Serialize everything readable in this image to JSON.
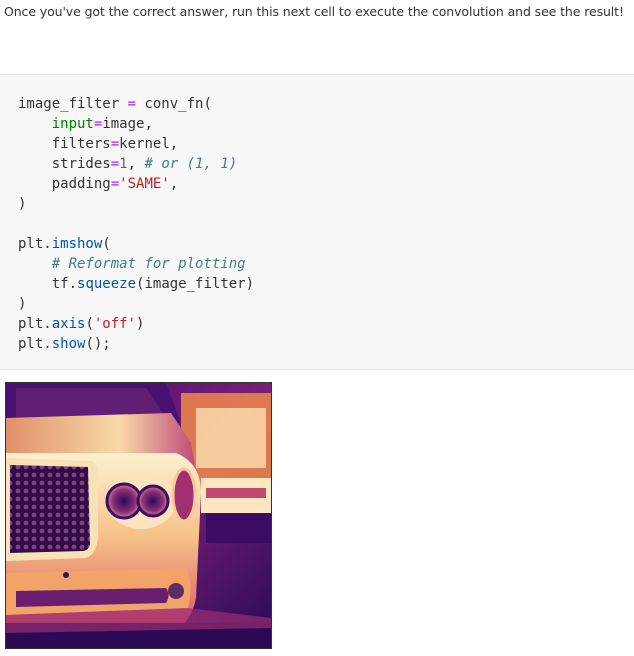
{
  "intro": {
    "text": "Once you've got the correct answer, run this next cell to execute the convolution and see the result!"
  },
  "code": {
    "l1_a": "image_filter ",
    "l1_op": "=",
    "l1_b": " conv_fn(",
    "l2_indent": "    ",
    "l2_kw": "input",
    "l2_op": "=",
    "l2_val": "image,",
    "l3_indent": "    ",
    "l3_kw": "filters",
    "l3_op": "=",
    "l3_val": "kernel,",
    "l4_indent": "    ",
    "l4_kw": "strides",
    "l4_op": "=",
    "l4_num": "1",
    "l4_comma": ", ",
    "l4_comment": "# or (1, 1)",
    "l5_indent": "    ",
    "l5_kw": "padding",
    "l5_op": "=",
    "l5_str": "'SAME'",
    "l5_comma": ",",
    "l6": ")",
    "l8_a": "plt.",
    "l8_fn": "imshow",
    "l8_b": "(",
    "l9_indent": "    ",
    "l9_comment": "# Reformat for plotting",
    "l10_indent": "    ",
    "l10_a": "tf.",
    "l10_fn": "squeeze",
    "l10_b": "(image_filter)",
    "l11": ")",
    "l12_a": "plt.",
    "l12_fn": "axis",
    "l12_b": "(",
    "l12_str": "'off'",
    "l12_c": ")",
    "l13_a": "plt.",
    "l13_fn": "show",
    "l13_b": "();"
  },
  "output": {
    "image_desc_icon": "car-front-image-icon",
    "colors": {
      "dark": "#2a0a55",
      "mid": "#b0306e",
      "warm": "#f08a4a",
      "light": "#fbe0b0",
      "bright": "#fdf0cf"
    }
  }
}
